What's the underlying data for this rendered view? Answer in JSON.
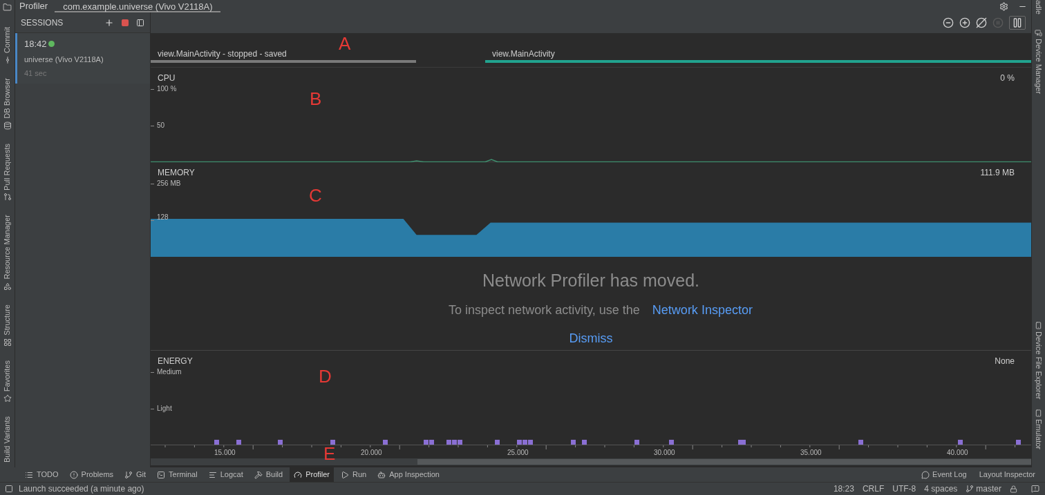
{
  "top_bar": {
    "title": "Profiler",
    "tab": "com.example.universe (Vivo V2118A)",
    "right_stripe_label": "adle"
  },
  "left_tool_windows": [
    "Commit",
    "DB Browser",
    "Pull Requests",
    "Resource Manager",
    "Structure",
    "Favorites",
    "Build Variants"
  ],
  "right_tool_windows": [
    "Device Manager",
    "Device File Explorer",
    "Emulator"
  ],
  "sessions": {
    "title": "SESSIONS",
    "items": [
      {
        "time": "18:42",
        "live": true,
        "name": "universe (Vivo V2118A)",
        "duration": "41 sec",
        "selected": true
      }
    ]
  },
  "toolbar": [
    {
      "kind": "zoom-out",
      "disabled": false
    },
    {
      "kind": "zoom-in",
      "disabled": false
    },
    {
      "kind": "reset",
      "disabled": false
    },
    {
      "kind": "live",
      "disabled": true
    },
    {
      "kind": "pause",
      "disabled": false
    }
  ],
  "activities": [
    {
      "label": "view.MainActivity - stopped - saved",
      "kind": "stopped"
    },
    {
      "label": "view.MainActivity",
      "kind": "active"
    }
  ],
  "cpu": {
    "title": "CPU",
    "reading": "0 %",
    "kind": "line",
    "axis_labels": [
      "100 %",
      "50"
    ]
  },
  "memory": {
    "title": "MEMORY",
    "reading": "111.9 MB",
    "kind": "area",
    "axis_labels": [
      "256 MB",
      "128"
    ]
  },
  "notice": {
    "title": "Network Profiler has moved.",
    "text": "To inspect network activity, use the",
    "link": "Network Inspector",
    "action": "Dismiss"
  },
  "energy": {
    "title": "ENERGY",
    "reading": "None",
    "levels": [
      "Medium",
      "Light"
    ]
  },
  "time_axis": [
    "15.000",
    "20.000",
    "25.000",
    "30.000",
    "35.000",
    "40.000"
  ],
  "annotations": [
    "A",
    "B",
    "C",
    "D",
    "E"
  ],
  "bottom_tools": [
    {
      "label": "TODO",
      "selected": false
    },
    {
      "label": "Problems",
      "selected": false
    },
    {
      "label": "Git",
      "selected": false
    },
    {
      "label": "Terminal",
      "selected": false
    },
    {
      "label": "Logcat",
      "selected": false
    },
    {
      "label": "Build",
      "selected": false
    },
    {
      "label": "Profiler",
      "selected": true
    },
    {
      "label": "Run",
      "selected": false
    },
    {
      "label": "App Inspection",
      "selected": false
    }
  ],
  "bottom_tools_right": [
    "Event Log",
    "Layout Inspector"
  ],
  "status_bar": {
    "message": "Launch succeeded (a minute ago)",
    "items": [
      "18:23",
      "CRLF",
      "UTF-8",
      "4 spaces",
      "master"
    ]
  }
}
